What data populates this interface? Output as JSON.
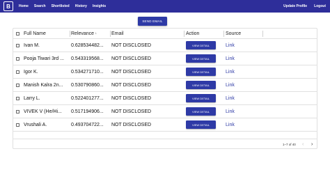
{
  "app": {
    "logo_text": "B",
    "nav_left": [
      "Home",
      "Search",
      "Shortlisted",
      "History",
      "Insights"
    ],
    "nav_right": [
      "Update Profile",
      "Logout"
    ]
  },
  "toolbar": {
    "send_email_label": "SEND EMAIL"
  },
  "table": {
    "columns": {
      "name": "Full Name",
      "relevance": "Relevance",
      "relevance_sort": "↓",
      "email": "Email",
      "action": "Action",
      "source": "Source"
    },
    "rows": [
      {
        "name": "Ivan M.",
        "relevance": "0.628534482...",
        "email": "NOT DISCLOSED",
        "action": "VIEW DETAIL",
        "source": "Link"
      },
      {
        "name": "Pooja Tiwari 3rd ...",
        "relevance": "0.543319568...",
        "email": "NOT DISCLOSED",
        "action": "VIEW DETAIL",
        "source": "Link"
      },
      {
        "name": "Igor K.",
        "relevance": "0.534271710...",
        "email": "NOT DISCLOSED",
        "action": "VIEW DETAIL",
        "source": "Link"
      },
      {
        "name": "Manish Kalra 2n...",
        "relevance": "0.530790860...",
        "email": "NOT DISCLOSED",
        "action": "VIEW DETAIL",
        "source": "Link"
      },
      {
        "name": "Larry L.",
        "relevance": "0.522401277...",
        "email": "NOT DISCLOSED",
        "action": "VIEW DETAIL",
        "source": "Link"
      },
      {
        "name": "VIVEK V (He/Hi...",
        "relevance": "0.517194906...",
        "email": "NOT DISCLOSED",
        "action": "VIEW DETAIL",
        "source": "Link"
      },
      {
        "name": "Vrushali A.",
        "relevance": "0.493704722...",
        "email": "NOT DISCLOSED",
        "action": "VIEW DETAIL",
        "source": "Link"
      }
    ]
  },
  "pagination": {
    "range_text": "1–7 of 40",
    "prev": "‹",
    "next": "›"
  },
  "colors": {
    "primary": "#2e2e9a",
    "button": "#2e3aa6",
    "link": "#2e3aa6"
  }
}
